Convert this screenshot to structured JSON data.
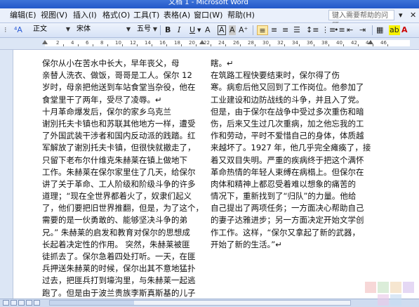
{
  "window": {
    "title": "文档 1 - Microsoft Word"
  },
  "menu": {
    "items": [
      "编辑(E)",
      "视图(V)",
      "插入(I)",
      "格式(O)",
      "工具(T)",
      "表格(A)",
      "窗口(W)",
      "帮助(H)"
    ],
    "help_placeholder": "键入需要帮助的问题"
  },
  "toolbar": {
    "style": "正文",
    "font": "宋体",
    "size": "五号",
    "bold": "B",
    "italic": "I",
    "underline": "U",
    "char_format": "A",
    "char_border": "A",
    "char_shade": "A"
  },
  "ruler": {
    "numbers": [
      "2",
      "4",
      "6",
      "8",
      "10",
      "12",
      "14",
      "16",
      "18",
      "20",
      "22",
      "24",
      "26",
      "28",
      "30",
      "32",
      "34",
      "36",
      "38",
      "40",
      "42",
      "44",
      "46"
    ]
  },
  "document": {
    "column1": [
      "保尔从小在苦水中长大，早年丧父，母",
      "亲替人洗衣、做饭，哥哥是工人。保尔 12",
      "岁时，母亲把他送到车站食堂当杂役，他在",
      "食堂里干了两年，受尽了凌辱。↵",
      "    十月革命爆发后，保尔的家乡乌克兰",
      "谢別托夫卡镇也和苏联其他地方一样，遭受",
      "了外国武装干涉者和国内反动派的践踏。红",
      "军解放了谢別托夫卡镇，但很快就撤走了，",
      "只留下老布尔什维克朱赫莱在镇上做地下",
      "工作。朱赫莱在保尔家里住了几天，给保尔",
      "讲了关于革命、工人阶级和阶级斗争的许多",
      "道理；“现在全世界都着火了，奴隶们起义",
      "了，他们要把旧世界推翻，但是，为了这个，",
      "需要的是一伙勇敢的、能够坚决斗争的弟",
      "兄。” 朱赫莱的启发和教育对保尔的思想成",
      "长起着决定性的作用。  突然，朱赫莱被匪",
      "徒抓去了。保尔急着四处打听。一天，在匪",
      "兵押送朱赫莱的时候，保尔出其不意地猛扑",
      "过去，把匪兵打到壕沟里，与朱赫莱一起逃",
      "跑了。但是由于波兰贵族李斯真斯基的儿子"
    ],
    "column2": [
      "瞎。↵",
      "    在筑路工程快要结束时，保尔得了伤",
      "寒。病愈后他又回到了工作岗位。他参加了",
      "工业建设和边防战线的斗争，并且入了党。",
      "但是，由于保尔在战争中受过多次重伤和暗",
      "伤，后来又生过几次重病，加之他忘我的工",
      "作和劳动，平时不爱惜自己的身体，体质越",
      "来越坏了。1927 年，他几乎完全瘫痪了，接",
      "着又双目失明。严重的疾病终于把这个满怀",
      "革命热情的年轻人束缚在病榻上。但保尔在",
      "肉体和精神上都忍受着难以想象的痛苦的",
      "情况下，重新找到了“归队”的力量。他给",
      "自己提出了两项任务；一方面决心帮助自己",
      "的妻子达雅进步；另一方面决定开始文学创",
      "作工作。这样，“保尔又拿起了新的武器，",
      "开始了新的生活。”↵"
    ]
  }
}
